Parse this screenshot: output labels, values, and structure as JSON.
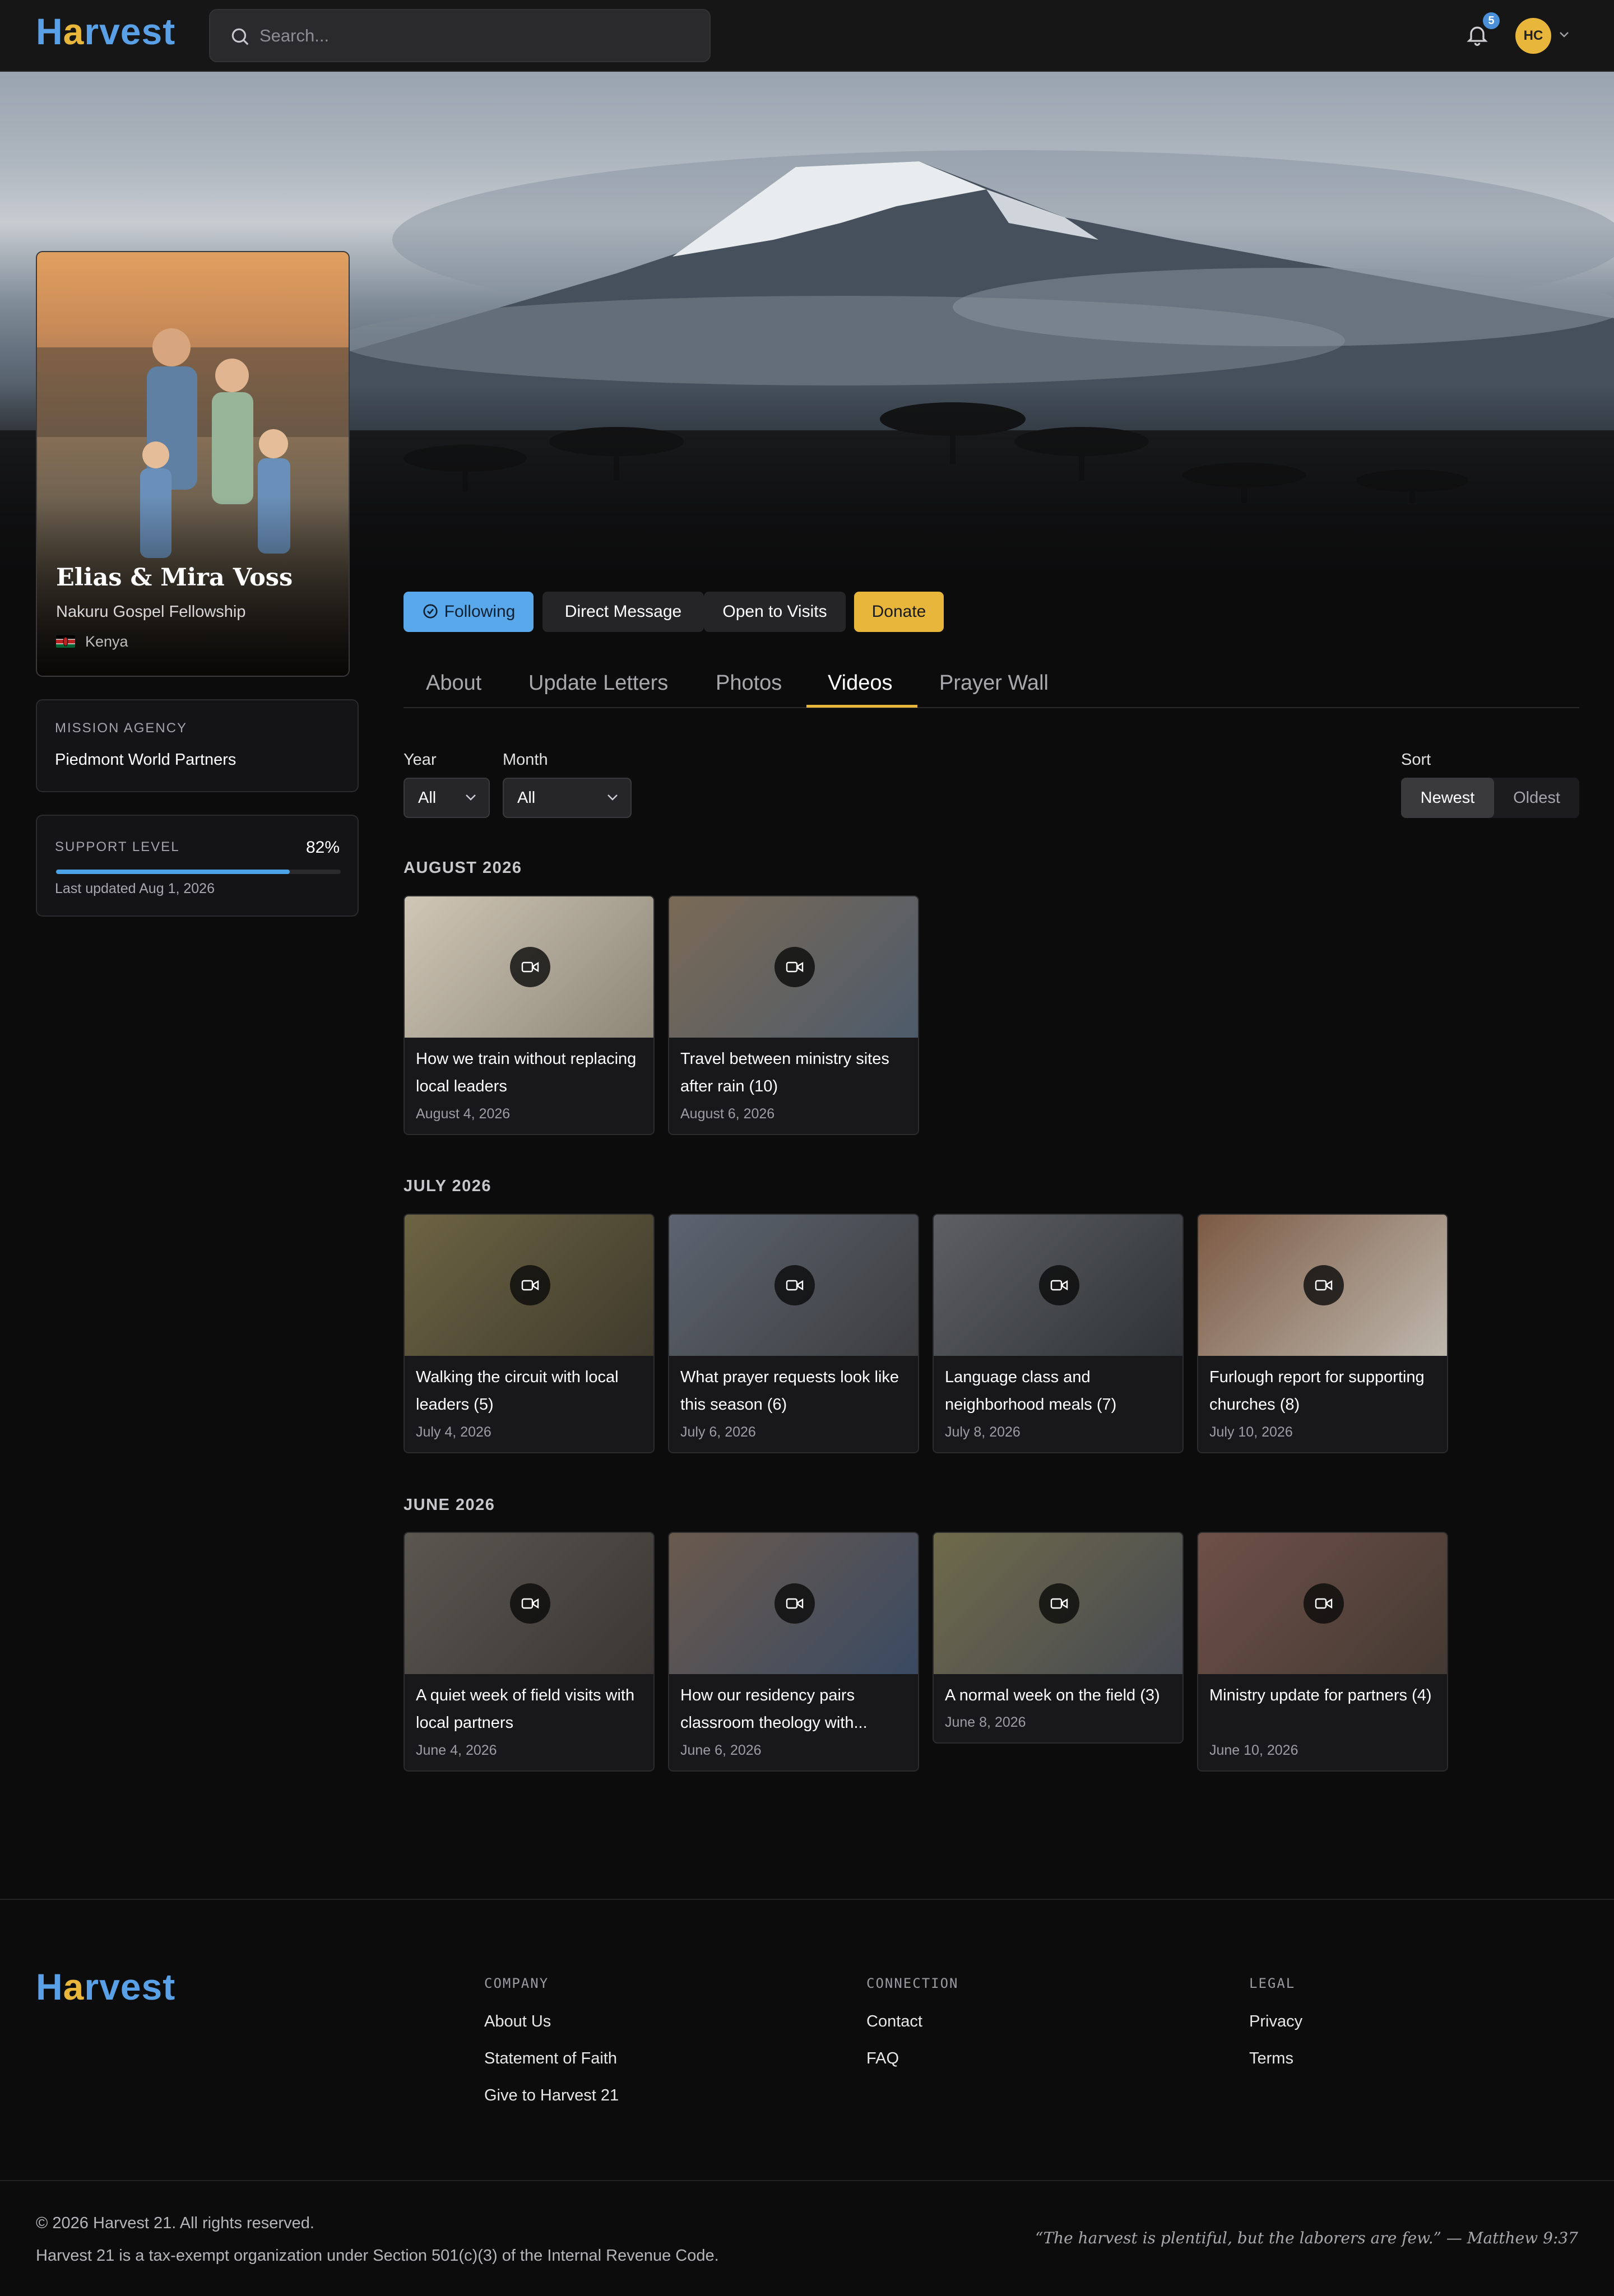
{
  "nav": {
    "logo": {
      "pre": "H",
      "accent": "a",
      "post": "rvest"
    },
    "search_placeholder": "Search...",
    "notifications_count": "5",
    "avatar_initials": "HC"
  },
  "profile": {
    "name": "Elias & Mira Voss",
    "organization": "Nakuru Gospel Fellowship",
    "location": "Kenya",
    "flag": "kenya-flag-icon"
  },
  "mission": {
    "label": "MISSION AGENCY",
    "value": "Piedmont World Partners"
  },
  "support": {
    "label": "SUPPORT LEVEL",
    "percent": "82%",
    "level": 0.82,
    "updated": "Last updated Aug 1, 2026"
  },
  "actions": {
    "following": "Following",
    "direct_message": "Direct Message",
    "open_to_visits": "Open to Visits",
    "donate": "Donate"
  },
  "tabs": [
    "About",
    "Update Letters",
    "Photos",
    "Videos",
    "Prayer Wall"
  ],
  "active_tab": "Videos",
  "filters": {
    "year_label": "Year",
    "year_value": "All",
    "month_label": "Month",
    "month_value": "All",
    "sort_label": "Sort",
    "sort_newest": "Newest",
    "sort_oldest": "Oldest",
    "sort_selected": "Newest"
  },
  "sections": [
    {
      "month": "AUGUST 2026",
      "videos": [
        {
          "title": "How we train without replacing local leaders",
          "date": "August 4, 2026"
        },
        {
          "title": "Travel between ministry sites after rain (10)",
          "date": "August 6, 2026"
        }
      ]
    },
    {
      "month": "JULY 2026",
      "videos": [
        {
          "title": "Walking the circuit with local leaders (5)",
          "date": "July 4, 2026"
        },
        {
          "title": "What prayer requests look like this season (6)",
          "date": "July 6, 2026"
        },
        {
          "title": "Language class and neighborhood meals (7)",
          "date": "July 8, 2026"
        },
        {
          "title": "Furlough report for supporting churches (8)",
          "date": "July 10, 2026"
        }
      ]
    },
    {
      "month": "JUNE 2026",
      "videos": [
        {
          "title": "A quiet week of field visits with local partners",
          "date": "June 4, 2026"
        },
        {
          "title": "How our residency pairs classroom theology with...",
          "date": "June 6, 2026"
        },
        {
          "title": "A normal week on the field (3)",
          "date": "June 8, 2026"
        },
        {
          "title": "Ministry update for partners (4)",
          "date": "June 10, 2026"
        }
      ]
    }
  ],
  "footer": {
    "company_heading": "COMPANY",
    "company_links": [
      "About Us",
      "Statement of Faith",
      "Give to Harvest 21"
    ],
    "connection_heading": "CONNECTION",
    "connection_links": [
      "Contact",
      "FAQ"
    ],
    "legal_heading": "LEGAL",
    "legal_links": [
      "Privacy",
      "Terms"
    ],
    "copyright": "© 2026 Harvest 21. All rights reserved.",
    "tax_note": "Harvest 21 is a tax-exempt organization under Section 501(c)(3) of the Internal Revenue Code.",
    "quote": "“The harvest is plentiful, but the laborers are few.” — Matthew 9:37"
  },
  "colors": {
    "accent_blue": "#5aa0e6",
    "accent_gold": "#e8b63a",
    "background": "#0c0c0d"
  }
}
